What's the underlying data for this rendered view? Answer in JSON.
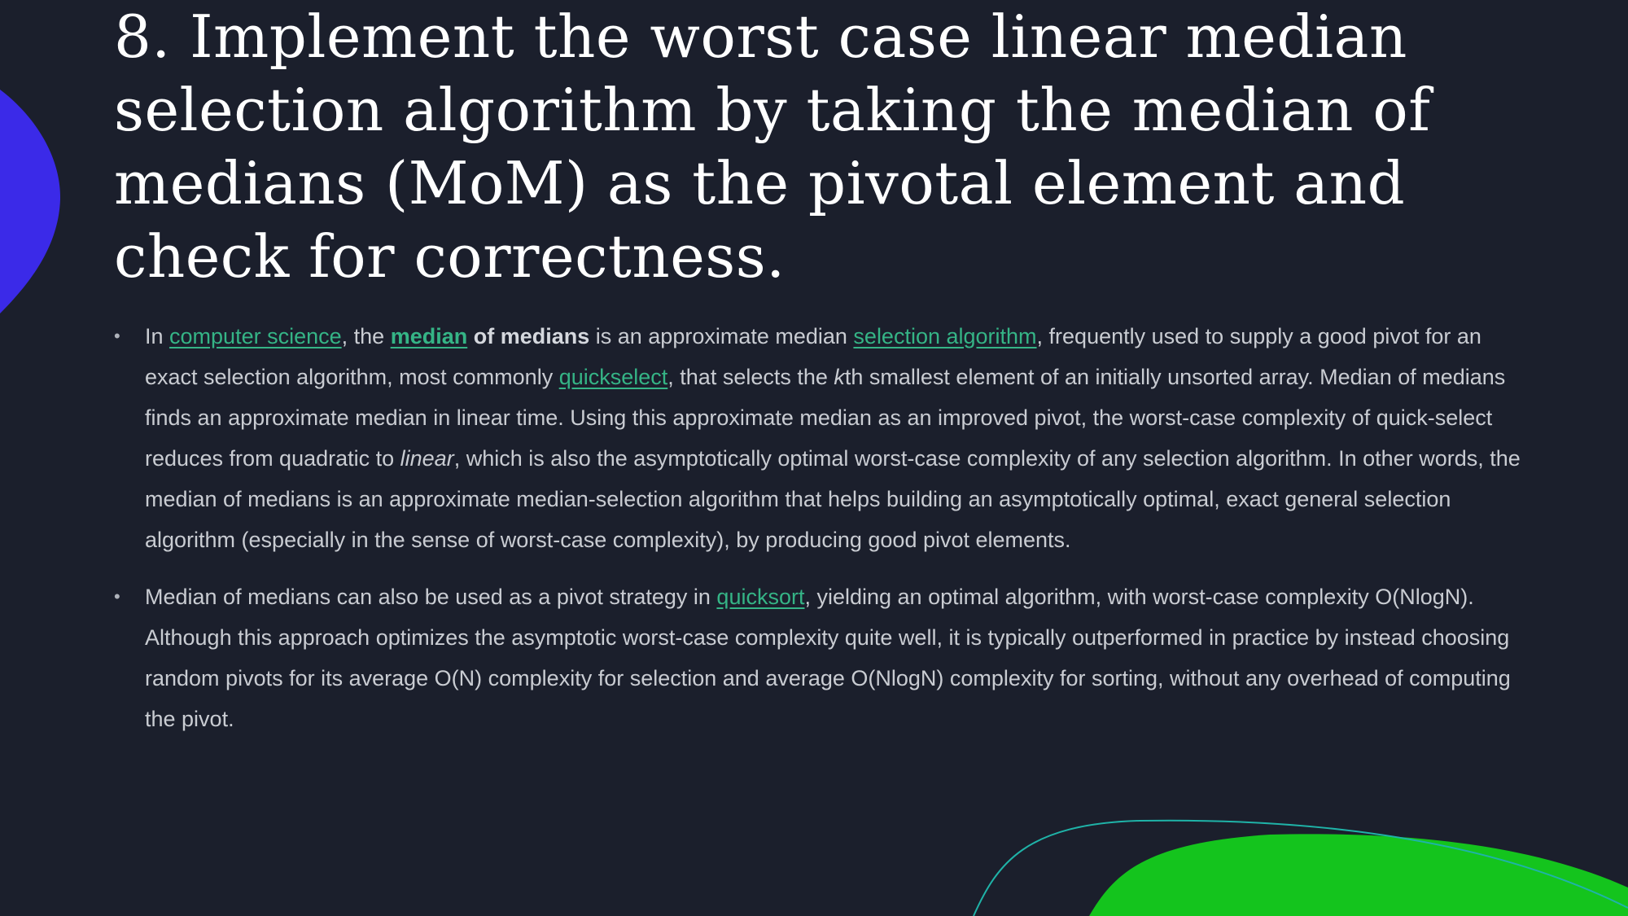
{
  "colors": {
    "background": "#1b1f2c",
    "title": "#ffffff",
    "body_text": "#c9ccd2",
    "link": "#35b486",
    "decor_blue": "#3b2ae8",
    "decor_green": "#14c41d",
    "decor_teal_line": "#1fb3a8"
  },
  "slide": {
    "title": "8. Implement the worst case linear median selection algorithm by taking the median of medians (MoM) as the pivotal element and check for correctness.",
    "bullets": [
      {
        "runs": [
          "In ",
          "computer science",
          ", the ",
          "median",
          " of medians",
          " is an approximate median ",
          "selection algorithm",
          ", frequently used to supply a good pivot for an exact selection algorithm, most commonly ",
          "quickselect",
          ", that selects the ",
          "k",
          "th smallest element of an initially unsorted array. Median of medians finds an approximate median in linear time. Using this approximate median as an improved pivot, the worst-case complexity of quick-select reduces from quadratic to ",
          "linear",
          ", which is also the asymptotically optimal worst-case complexity of any selection algorithm. In other words, the median of medians is an approximate median-selection algorithm that helps building an asymptotically optimal, exact general selection algorithm (especially in the sense of worst-case complexity), by producing good pivot elements."
        ]
      },
      {
        "runs": [
          "Median of medians can also be used as a pivot strategy in ",
          "quicksort",
          ", yielding an optimal algorithm, with worst-case complexity O(NlogN). Although this approach optimizes the asymptotic worst-case complexity quite well, it is typically outperformed in practice by instead choosing random pivots for its average O(N) complexity for selection and average O(NlogN) complexity for sorting, without any overhead of computing the pivot."
        ]
      }
    ],
    "bullet_glyph": "•"
  }
}
